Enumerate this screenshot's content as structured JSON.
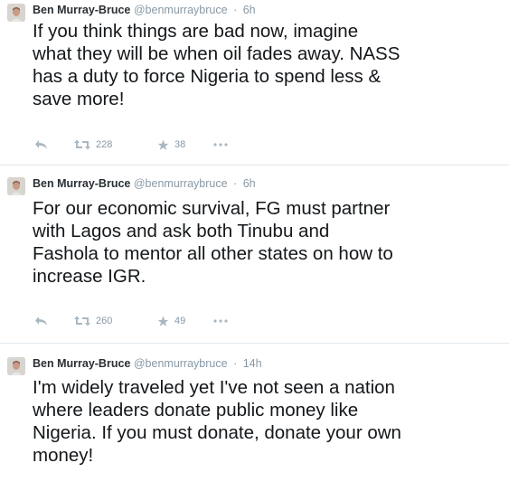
{
  "tweets": [
    {
      "author": "Ben Murray-Bruce",
      "handle": "@benmurraybruce",
      "time": "6h",
      "text": "If you think things are bad now, imagine\nwhat they will be when oil fades away. NASS\nhas a duty to force Nigeria to spend less &\nsave more!",
      "retweets": "228",
      "favorites": "38"
    },
    {
      "author": "Ben Murray-Bruce",
      "handle": "@benmurraybruce",
      "time": "6h",
      "text": "For our economic survival, FG must partner\nwith Lagos and ask both Tinubu and\nFashola to mentor all other states on how to\nincrease IGR.",
      "retweets": "260",
      "favorites": "49"
    },
    {
      "author": "Ben Murray-Bruce",
      "handle": "@benmurraybruce",
      "time": "14h",
      "text": "I'm widely traveled yet I've not seen a nation\nwhere leaders donate public money like\nNigeria. If you must donate, donate your own\nmoney!"
    }
  ],
  "separator": "·",
  "icons": {
    "reply": "reply-icon",
    "retweet": "retweet-icon",
    "favorite": "star-icon",
    "more": "more-icon",
    "avatar": "avatar"
  },
  "colors": {
    "text": "#14171a",
    "meta": "#8899a6",
    "divider": "#e1e8ed"
  }
}
